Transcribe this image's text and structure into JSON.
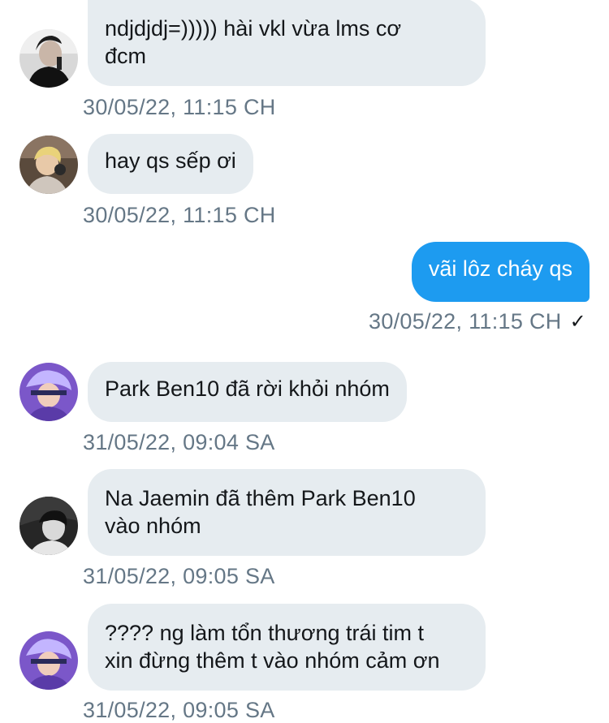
{
  "messages": [
    {
      "text": "ndjdjdj=))))) hài vkl vừa lms cơ\nđcm",
      "time": "30/05/22, 11:15 CH",
      "avatar": "avatar-man-black-white"
    },
    {
      "text": "hay qs sếp ơi",
      "time": "30/05/22, 11:15 CH",
      "avatar": "avatar-singer-studio"
    },
    {
      "text": "vãi lôz cháy qs",
      "time": "30/05/22, 11:15 CH",
      "status": "✓"
    },
    {
      "text": "Park Ben10 đã rời khỏi nhóm",
      "time": "31/05/22, 09:04 SA",
      "avatar": "avatar-purple-hair"
    },
    {
      "text": "Na Jaemin đã thêm Park Ben10\nvào nhóm",
      "time": "31/05/22, 09:05 SA",
      "avatar": "avatar-grayscale-boy"
    },
    {
      "text": " ???? ng làm tổn thương trái tim t\nxin đừng thêm t vào nhóm cảm ơn",
      "time": "31/05/22, 09:05 SA",
      "avatar": "avatar-purple-hair"
    }
  ],
  "colors": {
    "incoming_bubble": "#e6ecf0",
    "outgoing_bubble": "#1d9bf0",
    "timestamp": "#657786"
  }
}
